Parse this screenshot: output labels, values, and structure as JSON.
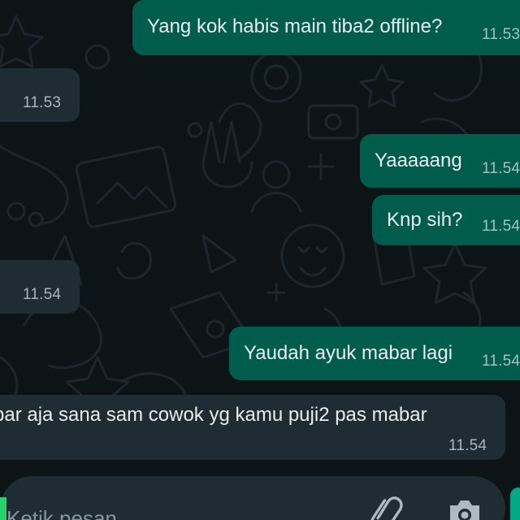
{
  "chat": {
    "messages": [
      {
        "direction": "out",
        "text": "Yang kok habis main tiba2 offline?",
        "time": "11.53"
      },
      {
        "direction": "in",
        "text": "",
        "time": "11.53"
      },
      {
        "direction": "out",
        "text": "Yaaaaang",
        "time": "11.54"
      },
      {
        "direction": "out",
        "text": "Knp sih?",
        "time": "11.54"
      },
      {
        "direction": "in",
        "text": "",
        "time": "11.54"
      },
      {
        "direction": "out",
        "text": "Yaudah ayuk mabar lagi",
        "time": "11.54"
      },
      {
        "direction": "in",
        "text": "bar aja sana sam cowok yg kamu puji2 pas mabar",
        "time": "11.54"
      }
    ]
  },
  "composer": {
    "placeholder": "Ketik pesan",
    "attach_icon": "paperclip-icon",
    "camera_icon": "camera-icon"
  },
  "colors": {
    "background": "#0d1418",
    "outgoing_bubble": "#005c4b",
    "incoming_bubble": "#1f2c34",
    "text": "#e9edef",
    "timestamp": "#a7b5bd",
    "accent": "#00a884"
  }
}
